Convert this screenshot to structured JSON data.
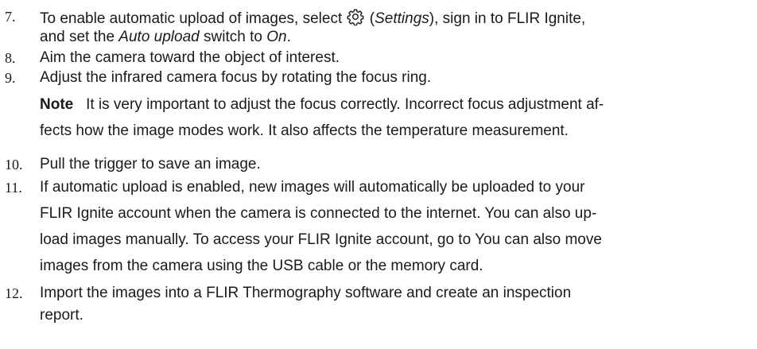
{
  "steps": [
    {
      "number": "7.",
      "line1_a": "To enable automatic upload of images, select ",
      "icon": "gear-icon",
      "line1_b": " (",
      "settings_label": "Settings",
      "line1_c": "), sign in to FLIR Ignite,",
      "line2_a": "and set the ",
      "auto_upload": "Auto upload",
      "line2_b": " switch to ",
      "on": "On",
      "line2_c": "."
    },
    {
      "number": "8.",
      "text": "Aim the camera toward the object of interest."
    },
    {
      "number": "9.",
      "text": "Adjust the infrared camera focus by rotating the focus ring."
    },
    {
      "note_label": "Note",
      "note_line1": "It is very important to adjust the focus correctly. Incorrect focus adjustment af-",
      "note_line2": "fects how the image modes work. It also affects the temperature measurement."
    },
    {
      "number": "10.",
      "text": "Pull the trigger to save an image."
    },
    {
      "number": "11.",
      "lines": [
        "If automatic upload is enabled, new images will automatically be uploaded to your",
        "FLIR Ignite account when the camera is connected to the internet. You can also up-",
        "load images manually. To access your FLIR Ignite account, go to  You can also move",
        "images from the camera using the USB cable or the memory card."
      ]
    },
    {
      "number": "12.",
      "lines": [
        "Import the images into a FLIR Thermography software and create an inspection",
        "report."
      ]
    }
  ]
}
